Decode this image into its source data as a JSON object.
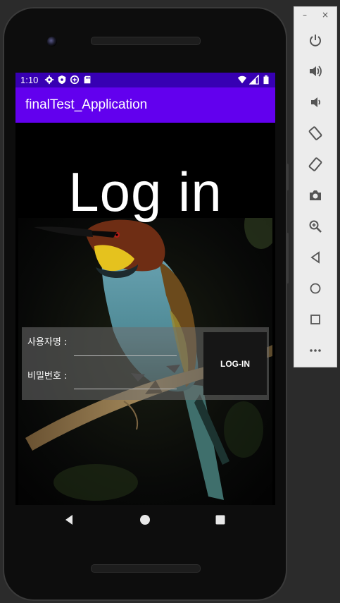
{
  "status_bar": {
    "time": "1:10",
    "left_icons": [
      "settings-icon",
      "shield-icon",
      "data-saver-icon",
      "sd-card-icon"
    ],
    "right_icons": [
      "wifi-icon",
      "signal-icon",
      "battery-icon"
    ]
  },
  "app_bar": {
    "title": "finalTest_Application",
    "color": "#6200ee"
  },
  "status_bar_color": "#3700b3",
  "login": {
    "heading": "Log in",
    "username_label": "사용자명 :",
    "username_value": "",
    "password_label": "비밀번호 :",
    "password_value": "",
    "button_label": "LOG-IN"
  },
  "nav_bar": {
    "buttons": [
      "back-icon",
      "home-icon",
      "recents-icon"
    ]
  },
  "emulator_toolbar": {
    "window_controls": {
      "minimize": "–",
      "close": "×"
    },
    "buttons": [
      "power-icon",
      "volume-up-icon",
      "volume-down-icon",
      "rotate-left-icon",
      "rotate-right-icon",
      "screenshot-icon",
      "zoom-icon",
      "back-icon",
      "home-icon",
      "overview-icon",
      "more-icon"
    ]
  }
}
